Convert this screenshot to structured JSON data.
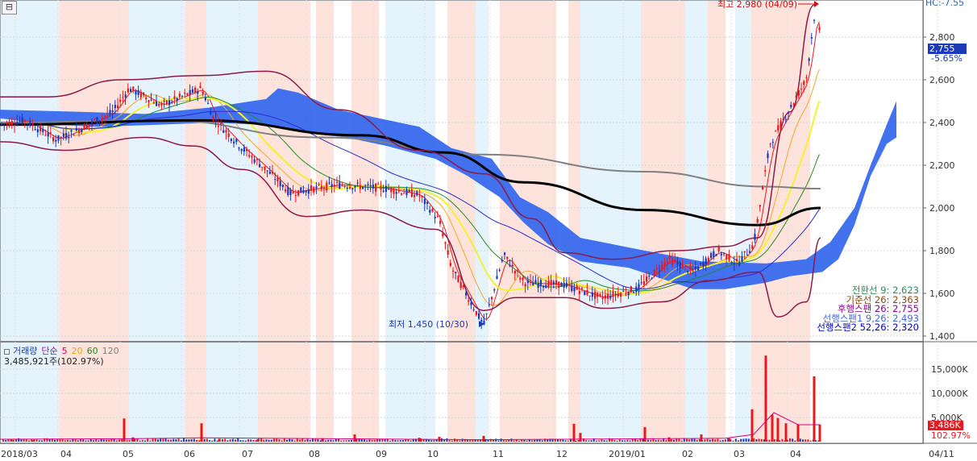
{
  "header": {
    "collapse_label": "⊟",
    "hc_label": "HC:-7.55"
  },
  "price_panel": {
    "current_price": "2,755",
    "current_change": "-5.65%",
    "high_label": "최고 2,980 (04/09)",
    "low_label": "최저 1,450 (10/30)",
    "indicators": [
      {
        "text": "전환선 9: 2,623",
        "color": "#2e8b57"
      },
      {
        "text": "기준선 26: 2,363",
        "color": "#8b4513"
      },
      {
        "text": "후행스팬 26: 2,755",
        "color": "#8b008b"
      },
      {
        "text": "선행스팬1 9,26: 2,493",
        "color": "#4169e1"
      },
      {
        "text": "선행스팬2 52,26: 2,320",
        "color": "#0000cd"
      }
    ]
  },
  "volume_panel": {
    "legend": [
      {
        "text": "거래량",
        "color": "#1e3c9b"
      },
      {
        "text": "단순",
        "color": "#b000b0"
      },
      {
        "text": "5",
        "color": "#d4007a"
      },
      {
        "text": "20",
        "color": "#e0b000"
      },
      {
        "text": "60",
        "color": "#228b22"
      },
      {
        "text": "120",
        "color": "#808080"
      }
    ],
    "summary": "3,485,921주(102.97%)",
    "current_volume": "3,486K",
    "current_ratio": "102.97%"
  },
  "colors": {
    "up": "#e8191e",
    "down": "#1c39bb",
    "cloud": "#3366ee",
    "band_red": "#fde3db",
    "band_blue": "#e4f3fc",
    "ma5": "#e8191e",
    "ma20": "#f5a623",
    "ma60": "#228b22",
    "ma120": "#2a2ad0",
    "ma_yellow": "#f2f232",
    "ma200": "#000000",
    "ma_gray": "#808080",
    "bollinger": "#8b1a4a"
  },
  "chart_data": [
    {
      "type": "candlestick",
      "title": "",
      "ylim": [
        1380,
        3000
      ],
      "y_ticks": [
        1400,
        1600,
        1800,
        2000,
        2200,
        2400,
        2600,
        2800
      ],
      "y_tick_labels": [
        "1,400",
        "1,600",
        "1,800",
        "2,000",
        "2,200",
        "2,400",
        "2,600",
        "2,800"
      ],
      "x_ticks": [
        "2018/03",
        "04",
        "05",
        "06",
        "07",
        "08",
        "09",
        "10",
        "11",
        "12",
        "2019/01",
        "02",
        "03",
        "04",
        "04/11"
      ],
      "close_path": [
        [
          "2018/03",
          2390
        ],
        [
          "03",
          2410
        ],
        [
          "04",
          2320
        ],
        [
          "04",
          2370
        ],
        [
          "05",
          2450
        ],
        [
          "05",
          2560
        ],
        [
          "05",
          2480
        ],
        [
          "06",
          2560
        ],
        [
          "06",
          2420
        ],
        [
          "07",
          2280
        ],
        [
          "07",
          2180
        ],
        [
          "08",
          2070
        ],
        [
          "08",
          2110
        ],
        [
          "09",
          2090
        ],
        [
          "09",
          2060
        ],
        [
          "10",
          1940
        ],
        [
          "10",
          1720
        ],
        [
          "10/30",
          1450
        ],
        [
          "11",
          1780
        ],
        [
          "11",
          1650
        ],
        [
          "12",
          1640
        ],
        [
          "12",
          1580
        ],
        [
          "2019/01",
          1620
        ],
        [
          "01",
          1760
        ],
        [
          "02",
          1700
        ],
        [
          "02",
          1800
        ],
        [
          "03",
          1740
        ],
        [
          "03",
          1830
        ],
        [
          "03",
          2300
        ],
        [
          "04",
          2600
        ],
        [
          "04/09",
          2980
        ],
        [
          "04",
          2755
        ]
      ],
      "high": {
        "value": 2980,
        "date": "04/09"
      },
      "low": {
        "value": 1450,
        "date": "10/30"
      },
      "last": 2755
    },
    {
      "type": "bar",
      "title": "거래량",
      "ylim": [
        0,
        18000
      ],
      "y_ticks": [
        5000,
        10000,
        15000
      ],
      "y_tick_labels": [
        "5,000K",
        "10,000K",
        "15,000K"
      ],
      "values_k": [
        500,
        800,
        4800,
        500,
        3800,
        500,
        800,
        1500,
        1200,
        700,
        3700,
        1800,
        3000,
        1500,
        6700,
        17800,
        5600,
        4900,
        13500,
        3486
      ],
      "last": 3486
    }
  ]
}
